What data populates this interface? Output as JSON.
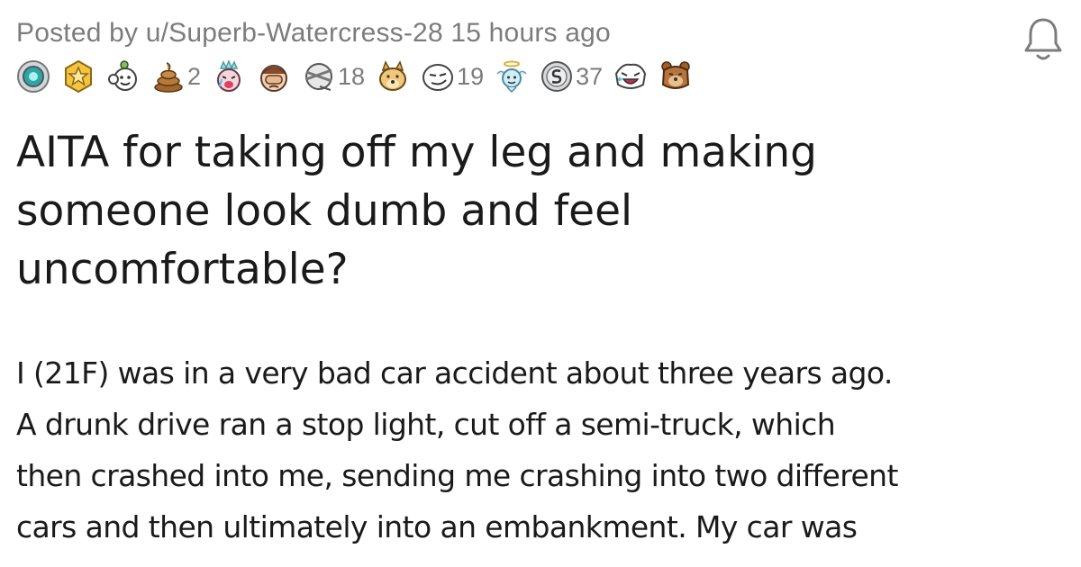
{
  "post": {
    "meta": "Posted by u/Superb-Watercress-28 15 hours ago",
    "title_lines": [
      "AITA for taking off my leg and making",
      "someone look dumb and feel",
      "uncomfortable?"
    ],
    "body_lines": [
      "I (21F) was in a very bad car accident about three years ago.",
      "A drunk drive ran a stop light, cut off a semi-truck, which",
      "then crashed into me, sending me crashing into two different",
      "cars and then ultimately into an embankment. My car was"
    ]
  },
  "awards": [
    {
      "icon": "platinum-award-icon",
      "count": ""
    },
    {
      "icon": "gold-award-icon",
      "count": ""
    },
    {
      "icon": "wholesome-award-icon",
      "count": ""
    },
    {
      "icon": "poop-award-icon",
      "count": "2"
    },
    {
      "icon": "crying-princess-award-icon",
      "count": ""
    },
    {
      "icon": "facepalm-award-icon",
      "count": ""
    },
    {
      "icon": "bandaged-award-icon",
      "count": "18"
    },
    {
      "icon": "doge-award-icon",
      "count": ""
    },
    {
      "icon": "smug-face-award-icon",
      "count": "19"
    },
    {
      "icon": "angel-award-icon",
      "count": ""
    },
    {
      "icon": "silver-award-icon",
      "count": "37"
    },
    {
      "icon": "laughing-award-icon",
      "count": ""
    },
    {
      "icon": "bear-award-icon",
      "count": ""
    }
  ],
  "colors": {
    "meta_text": "#7c7c7c",
    "title_text": "#1a1a1b",
    "body_text": "#1a1a1b"
  },
  "icons": {
    "notification": "bell-icon"
  }
}
